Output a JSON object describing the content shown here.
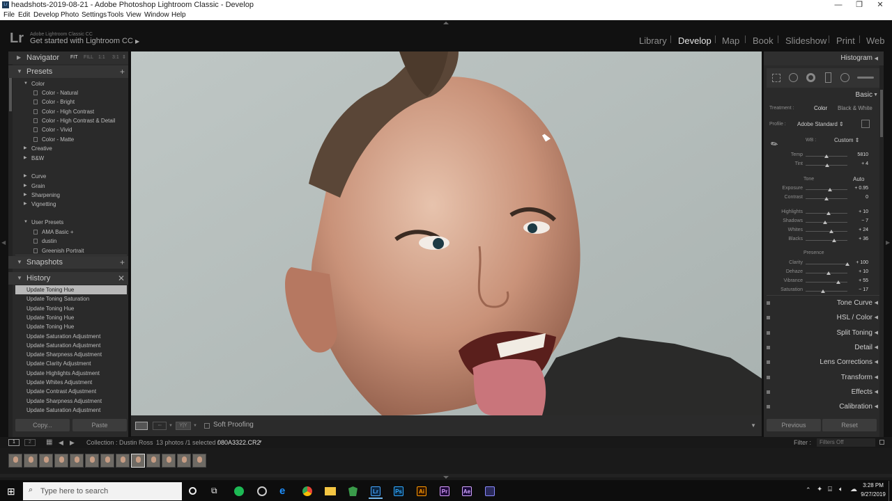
{
  "window": {
    "title": "headshots-2019-08-21 - Adobe Photoshop Lightroom Classic - Develop"
  },
  "menu": [
    "File",
    "Edit",
    "Develop",
    "Photo",
    "Settings",
    "Tools",
    "View",
    "Window",
    "Help"
  ],
  "identity": {
    "small": "Adobe Lightroom Classic CC",
    "main": "Get started with Lightroom CC",
    "logo": "Lr"
  },
  "modules": [
    "Library",
    "Develop",
    "Map",
    "Book",
    "Slideshow",
    "Print",
    "Web"
  ],
  "active_module": "Develop",
  "left": {
    "navigator": {
      "title": "Navigator",
      "opts": [
        "FIT",
        "FILL",
        "1:1",
        "3:1"
      ]
    },
    "presets": {
      "title": "Presets",
      "color_group": "Color",
      "color_items": [
        "Color - Natural",
        "Color - Bright",
        "Color - High Contrast",
        "Color - High Contrast & Detail",
        "Color - Vivid",
        "Color - Matte"
      ],
      "groups": [
        "Creative",
        "B&W",
        "Curve",
        "Grain",
        "Sharpening",
        "Vignetting"
      ],
      "user_group": "User Presets",
      "user_items": [
        "AMA Basic +",
        "dustin",
        "Greenish Portrait"
      ]
    },
    "snapshots": {
      "title": "Snapshots"
    },
    "history": {
      "title": "History",
      "items": [
        "Update Toning Hue",
        "Update Toning Saturation",
        "Update Toning Hue",
        "Update Toning Hue",
        "Update Toning Hue",
        "Update Saturation Adjustment",
        "Update Saturation Adjustment",
        "Update Sharpness Adjustment",
        "Update Clarity Adjustment",
        "Update Highlights Adjustment",
        "Update Whites Adjustment",
        "Update Contrast Adjustment",
        "Update Sharpness Adjustment",
        "Update Saturation Adjustment"
      ]
    },
    "buttons": {
      "copy": "Copy...",
      "paste": "Paste"
    }
  },
  "toolbar": {
    "soft_proofing": "Soft Proofing",
    "yy": "Y|Y"
  },
  "right": {
    "histogram": "Histogram",
    "basic": "Basic",
    "treatment_label": "Treatment :",
    "treatment_color": "Color",
    "treatment_bw": "Black & White",
    "profile_label": "Profile :",
    "profile_value": "Adobe Standard",
    "wb_label": "WB :",
    "wb_value": "Custom",
    "tone_label": "Tone",
    "auto": "Auto",
    "presence_label": "Presence",
    "sliders": [
      {
        "name": "Temp",
        "value": "5810",
        "pos": 0.5
      },
      {
        "name": "Tint",
        "value": "+ 4",
        "pos": 0.52
      },
      {
        "name": "Exposure",
        "value": "+ 0.95",
        "pos": 0.58
      },
      {
        "name": "Contrast",
        "value": "0",
        "pos": 0.5
      },
      {
        "name": "Highlights",
        "value": "+ 10",
        "pos": 0.55
      },
      {
        "name": "Shadows",
        "value": "− 7",
        "pos": 0.47
      },
      {
        "name": "Whites",
        "value": "+ 24",
        "pos": 0.62
      },
      {
        "name": "Blacks",
        "value": "+ 36",
        "pos": 0.68
      },
      {
        "name": "Clarity",
        "value": "+ 100",
        "pos": 1.0
      },
      {
        "name": "Dehaze",
        "value": "+ 10",
        "pos": 0.55
      },
      {
        "name": "Vibrance",
        "value": "+ 55",
        "pos": 0.78
      },
      {
        "name": "Saturation",
        "value": "− 17",
        "pos": 0.42
      }
    ],
    "sections": [
      "Tone Curve",
      "HSL / Color",
      "Split Toning",
      "Detail",
      "Lens Corrections",
      "Transform",
      "Effects",
      "Calibration"
    ],
    "previous": "Previous",
    "reset": "Reset"
  },
  "filmbar": {
    "collection": "Collection : Dustin Ross",
    "count": "13 photos /1 selected /",
    "filename": "080A3322.CR2",
    "filter_label": "Filter :",
    "filter_value": "Filters Off",
    "page1": "1",
    "page2": "2"
  },
  "filmstrip": {
    "count": 13,
    "selected_index": 8
  },
  "taskbar": {
    "search": "Type here to search",
    "time": "3:28 PM",
    "date": "9/27/2019",
    "apps": [
      {
        "label": "Lr",
        "bg": "#0b2540",
        "fg": "#46a6ff"
      },
      {
        "label": "Ps",
        "bg": "#08243a",
        "fg": "#31a8ff"
      },
      {
        "label": "Ai",
        "bg": "#2e1300",
        "fg": "#ff9a00"
      },
      {
        "label": "Pr",
        "bg": "#1f0a3a",
        "fg": "#d89bff"
      },
      {
        "label": "Ae",
        "bg": "#1a0a3a",
        "fg": "#d4a6ff"
      }
    ]
  },
  "colors": {
    "panel": "#2a2a2a",
    "bg": "#111111",
    "history_selected": "#b9b9b9",
    "active_module": "#e6e6e6"
  }
}
